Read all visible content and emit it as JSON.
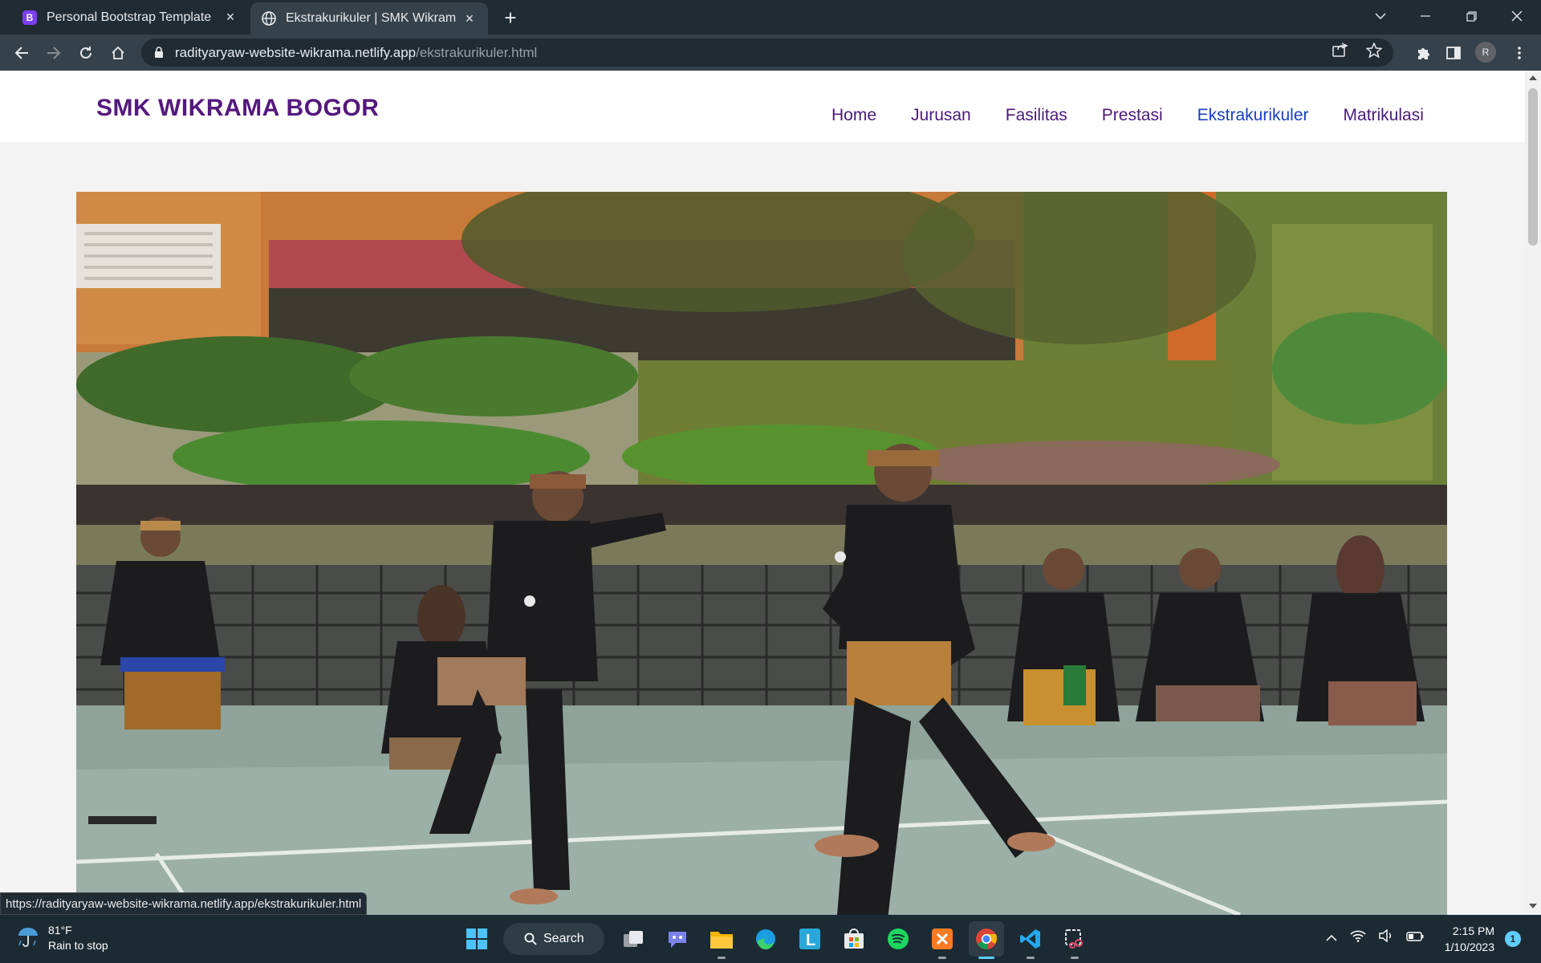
{
  "browser": {
    "tabs": [
      {
        "title": "Personal Bootstrap Template",
        "favicon": "bootstrap-b-icon",
        "favicon_letter": "B",
        "active": false
      },
      {
        "title": "Ekstrakurikuler | SMK Wikrama Bo",
        "favicon": "globe-icon",
        "active": true
      }
    ],
    "address": {
      "host": "radityaryaw-website-wikrama.netlify.app",
      "path": "/ekstrakurikuler.html"
    },
    "profile_initial": "R",
    "status_url": "https://radityaryaw-website-wikrama.netlify.app/ekstrakurikuler.html"
  },
  "site": {
    "brand": "SMK WIKRAMA BOGOR",
    "nav": [
      {
        "label": "Home",
        "active": false
      },
      {
        "label": "Jurusan",
        "active": false
      },
      {
        "label": "Fasilitas",
        "active": false
      },
      {
        "label": "Prestasi",
        "active": false
      },
      {
        "label": "Ekstrakurikuler",
        "active": true
      },
      {
        "label": "Matrikulasi",
        "active": false
      }
    ],
    "hero_image": "pencak-silat-performance-photo"
  },
  "taskbar": {
    "weather": {
      "temp": "81°F",
      "condition": "Rain to stop"
    },
    "search_label": "Search",
    "apps": [
      "start-icon",
      "search",
      "task-view-icon",
      "chat-icon",
      "file-explorer-icon",
      "edge-icon",
      "l-app-icon",
      "store-icon",
      "spotify-icon",
      "xampp-icon",
      "chrome-icon",
      "vscode-icon",
      "snipping-tool-icon"
    ],
    "clock": {
      "time": "2:15 PM",
      "date": "1/10/2023"
    },
    "notification_count": "1"
  },
  "colors": {
    "brand": "#54187e",
    "nav_active": "#1a3fc4",
    "chrome_dark": "#202b33",
    "chrome_mid": "#35424b"
  }
}
